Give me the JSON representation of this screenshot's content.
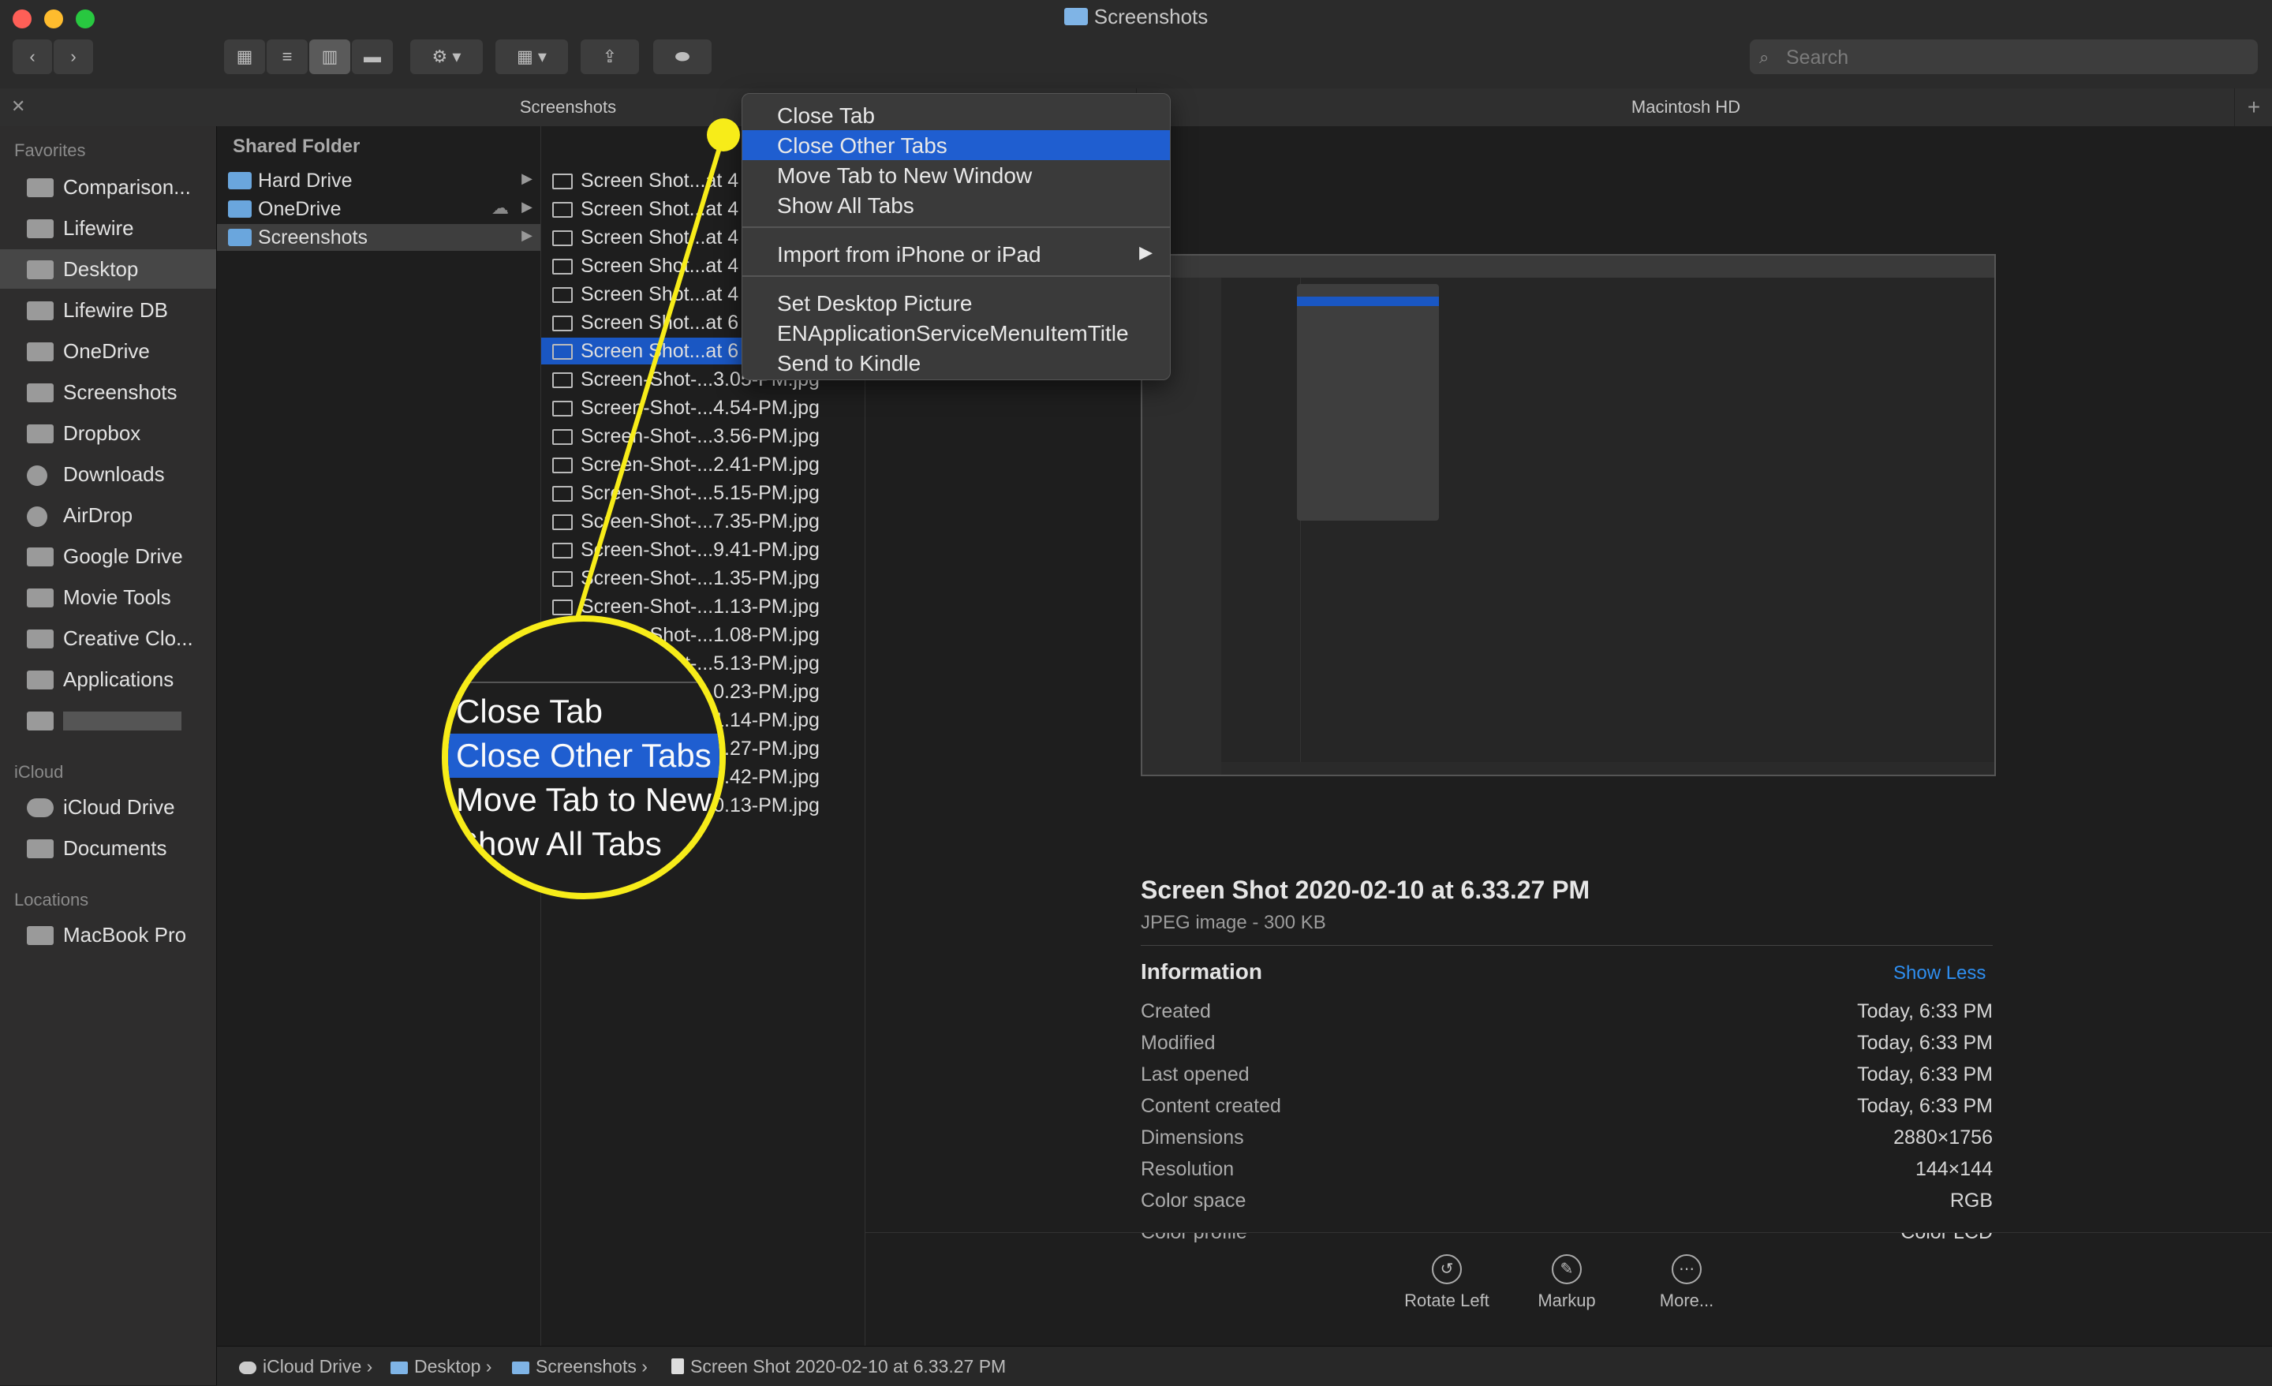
{
  "window": {
    "title": "Screenshots"
  },
  "toolbar": {
    "search_placeholder": "Search"
  },
  "tabs": [
    {
      "label": "Screenshots"
    },
    {
      "label": "Macintosh HD"
    }
  ],
  "sidebar": {
    "favorites_header": "Favorites",
    "favorites": [
      {
        "label": "Comparison..."
      },
      {
        "label": "Lifewire"
      },
      {
        "label": "Desktop"
      },
      {
        "label": "Lifewire DB"
      },
      {
        "label": "OneDrive"
      },
      {
        "label": "Screenshots"
      },
      {
        "label": "Dropbox"
      },
      {
        "label": "Downloads"
      },
      {
        "label": "AirDrop"
      },
      {
        "label": "Google Drive"
      },
      {
        "label": "Movie Tools"
      },
      {
        "label": "Creative Clo..."
      },
      {
        "label": "Applications"
      }
    ],
    "icloud_header": "iCloud",
    "icloud": [
      {
        "label": "iCloud Drive"
      },
      {
        "label": "Documents"
      }
    ],
    "locations_header": "Locations",
    "locations": [
      {
        "label": "MacBook Pro"
      }
    ]
  },
  "column1": {
    "header": "Shared Folder",
    "items": [
      {
        "label": "Hard Drive"
      },
      {
        "label": "OneDrive"
      },
      {
        "label": "Screenshots"
      }
    ]
  },
  "column2": {
    "items": [
      "Screen Shot...at 4",
      "Screen Shot...at 4",
      "Screen Shot...at 4",
      "Screen Shot...at 4",
      "Screen Shot...at 4",
      "Screen Shot...at 6",
      "Screen Shot...at 6",
      "Screen-Shot-...3.05-PM.jpg",
      "Screen-Shot-...4.54-PM.jpg",
      "Screen-Shot-...3.56-PM.jpg",
      "Screen-Shot-...2.41-PM.jpg",
      "Screen-Shot-...5.15-PM.jpg",
      "Screen-Shot-...7.35-PM.jpg",
      "Screen-Shot-...9.41-PM.jpg",
      "Screen-Shot-...1.35-PM.jpg",
      "Screen-Shot-...1.13-PM.jpg",
      "Screen-Shot-...1.08-PM.jpg",
      "Screen-Shot-...5.13-PM.jpg",
      "Screen-Shot-...0.23-PM.jpg",
      "Screen-Shot-...1.14-PM.jpg",
      "Screen-Shot-...3.27-PM.jpg",
      "Screen-Shot-...8.42-PM.jpg",
      "Screen-Shot-...0.13-PM.jpg"
    ]
  },
  "context_menu": {
    "group1": [
      "Close Tab",
      "Close Other Tabs",
      "Move Tab to New Window",
      "Show All Tabs"
    ],
    "group2": [
      "Import from iPhone or iPad"
    ],
    "group3": [
      "Set Desktop Picture",
      "ENApplicationServiceMenuItemTitle",
      "Send to Kindle"
    ]
  },
  "magnifier": {
    "items": [
      "Close Tab",
      "Close Other Tabs",
      "Move Tab to New",
      "Show All Tabs"
    ]
  },
  "preview": {
    "title": "Screen Shot 2020-02-10 at 6.33.27 PM",
    "subtitle": "JPEG image - 300 KB",
    "info_header": "Information",
    "show_less": "Show Less",
    "rows": [
      {
        "label": "Created",
        "value": "Today, 6:33 PM"
      },
      {
        "label": "Modified",
        "value": "Today, 6:33 PM"
      },
      {
        "label": "Last opened",
        "value": "Today, 6:33 PM"
      },
      {
        "label": "Content created",
        "value": "Today, 6:33 PM"
      },
      {
        "label": "Dimensions",
        "value": "2880×1756"
      },
      {
        "label": "Resolution",
        "value": "144×144"
      },
      {
        "label": "Color space",
        "value": "RGB"
      },
      {
        "label": "Color profile",
        "value": "Color LCD"
      }
    ],
    "actions": [
      {
        "label": "Rotate Left"
      },
      {
        "label": "Markup"
      },
      {
        "label": "More..."
      }
    ]
  },
  "pathbar": [
    "iCloud Drive",
    "Desktop",
    "Screenshots",
    "Screen Shot 2020-02-10 at 6.33.27 PM"
  ],
  "colors": {
    "accent": "#1f5ed0",
    "highlight_ring": "#f7ec19"
  }
}
